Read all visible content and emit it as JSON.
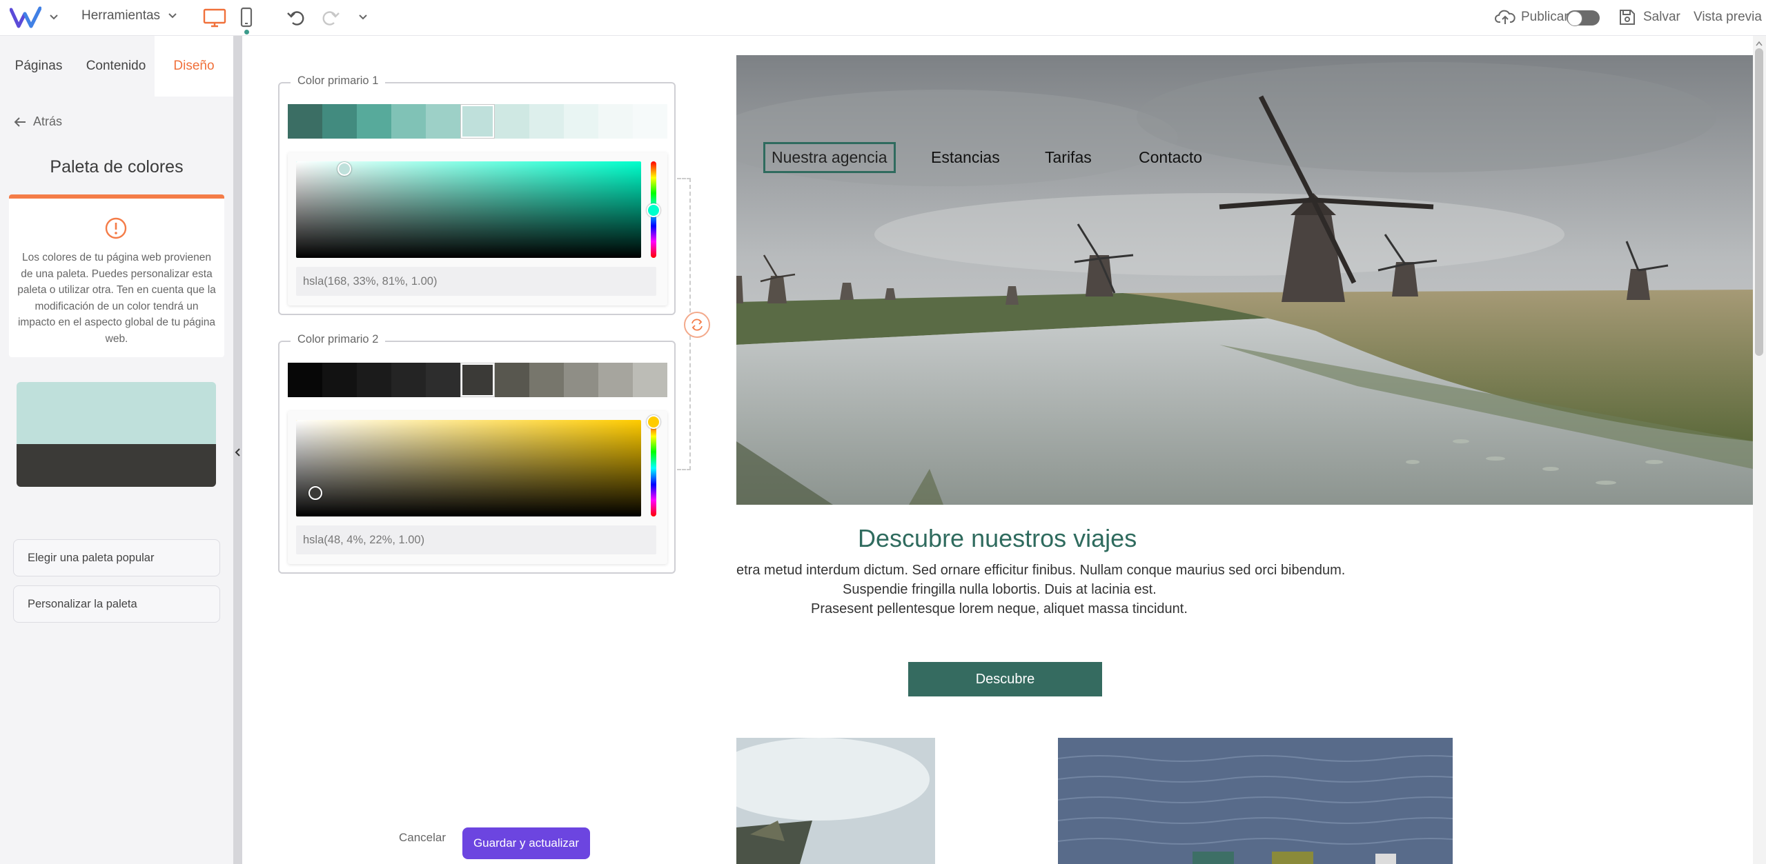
{
  "toolbar": {
    "tools_label": "Herramientas",
    "publish_label": "Publicar",
    "save_label": "Salvar",
    "preview_label": "Vista previa",
    "publish_toggle": false,
    "active_device": "desktop"
  },
  "sidebar": {
    "tabs": [
      {
        "label": "Páginas",
        "active": false
      },
      {
        "label": "Contenido",
        "active": false
      },
      {
        "label": "Diseño",
        "active": true
      }
    ],
    "back_label": "Atrás",
    "title": "Paleta de colores",
    "info_text": "Los colores de tu página web provienen de una paleta. Puedes personalizar esta paleta o utilizar otra. Ten en cuenta que la modificación de un color tendrá un impacto en el aspecto global de tu página web.",
    "palette_preview": [
      "#bfe0db",
      "#3b3a37"
    ],
    "buttons": {
      "choose_popular": "Elegir una paleta popular",
      "customize": "Personalizar la paleta"
    }
  },
  "editor": {
    "primary1": {
      "label": "Color primario 1",
      "shades": [
        "#3b6e64",
        "#428b7f",
        "#57aa9b",
        "#80c2b6",
        "#9dd0c7",
        "#bfe0db",
        "#cfe8e3",
        "#ddefec",
        "#e9f5f3",
        "#f2f8f7",
        "#f6fafa"
      ],
      "selected_index": 5,
      "hue_color": "#00ffcc",
      "handle_color": "#bfe0db",
      "value": "hsla(168, 33%, 81%, 1.00)"
    },
    "primary2": {
      "label": "Color primario 2",
      "shades": [
        "#070707",
        "#121212",
        "#1b1b1b",
        "#242424",
        "#2d2d2d",
        "#3b3a37",
        "#58574f",
        "#77766c",
        "#8f8e86",
        "#a6a59e",
        "#bcbcb6"
      ],
      "selected_index": 5,
      "hue_color": "#ffcc00",
      "handle_color": "#3b3a37",
      "value": "hsla(48, 4%, 22%, 1.00)"
    },
    "cancel_label": "Cancelar",
    "submit_label": "Guardar y actualizar"
  },
  "site": {
    "nav": [
      "Nuestra agencia",
      "Estancias",
      "Tarifas",
      "Contacto"
    ],
    "section_title": "Descubre nuestros viajes",
    "body_lines": [
      "etra metud interdum dictum. Sed ornare efficitur finibus. Nullam conque maurius sed orci bibendum.",
      "Suspendie fringilla nulla lobortis. Duis at lacinia est.",
      "Prasesent pellentesque lorem neque, aliquet massa tincidunt."
    ],
    "cta_label": "Descubre",
    "accent": "#2f6b5e"
  }
}
